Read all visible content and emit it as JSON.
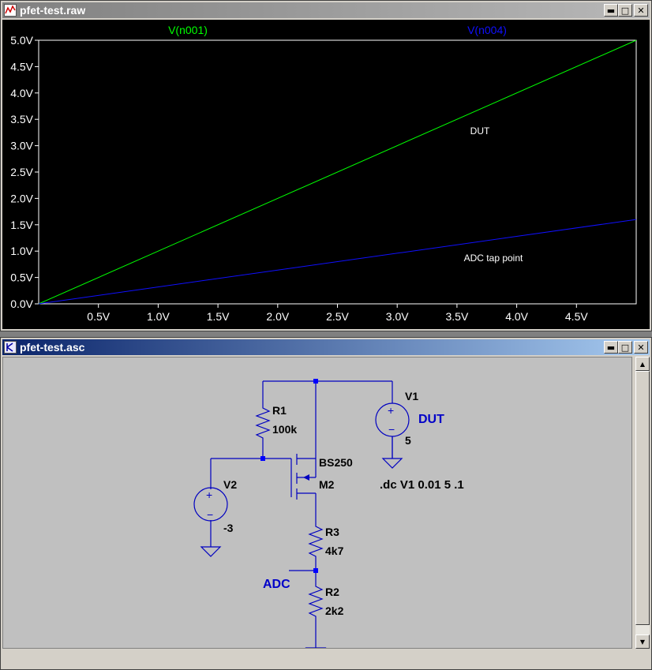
{
  "waveform_window": {
    "title": "pfet-test.raw",
    "icon": "waveform-icon",
    "buttons": {
      "minimize": "minimize-icon",
      "maximize": "maximize-icon",
      "close": "close-icon"
    }
  },
  "schematic_window": {
    "title": "pfet-test.asc",
    "icon": "schematic-icon",
    "buttons": {
      "minimize": "minimize-icon",
      "maximize": "maximize-icon",
      "close": "close-icon"
    }
  },
  "colors": {
    "trace1": "#00ff00",
    "trace2": "#1010ff",
    "wire": "#0000c0",
    "label_blue": "#0000c8"
  },
  "chart_data": {
    "type": "line",
    "x": [
      0,
      5
    ],
    "series": [
      {
        "name": "V(n001)",
        "color": "#00ff00",
        "x": [
          0,
          5
        ],
        "y": [
          0,
          5
        ]
      },
      {
        "name": "V(n004)",
        "color": "#1010ff",
        "x": [
          0,
          5
        ],
        "y": [
          0,
          1.6
        ]
      }
    ],
    "xlim": [
      0,
      5
    ],
    "ylim": [
      0,
      5
    ],
    "xticks": [
      "0.5V",
      "1.0V",
      "1.5V",
      "2.0V",
      "2.5V",
      "3.0V",
      "3.5V",
      "4.0V",
      "4.5V"
    ],
    "yticks": [
      "0.0V",
      "0.5V",
      "1.0V",
      "1.5V",
      "2.0V",
      "2.5V",
      "3.0V",
      "3.5V",
      "4.0V",
      "4.5V",
      "5.0V"
    ],
    "annotations": [
      "DUT",
      "ADC tap point"
    ],
    "grid": false,
    "legend": "top"
  },
  "schematic": {
    "r1_name": "R1",
    "r1_value": "100k",
    "v1_name": "V1",
    "v1_label": "DUT",
    "v1_value": "5",
    "m2_model": "BS250",
    "m2_name": "M2",
    "directive": ".dc V1 0.01 5 .1",
    "v2_name": "V2",
    "v2_value": "-3",
    "r3_name": "R3",
    "r3_value": "4k7",
    "adc_label": "ADC",
    "r2_name": "R2",
    "r2_value": "2k2"
  }
}
